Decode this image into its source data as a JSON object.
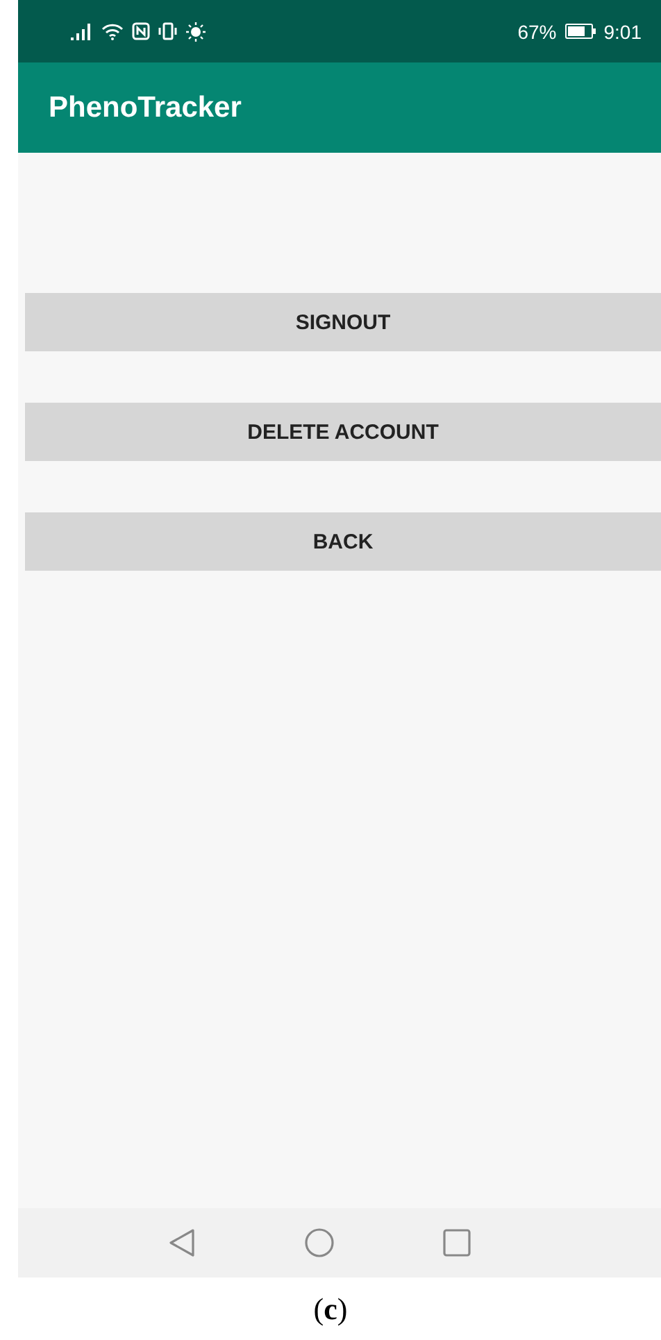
{
  "status_bar": {
    "battery_percent": "67%",
    "time": "9:01"
  },
  "app_bar": {
    "title": "PhenoTracker"
  },
  "buttons": [
    {
      "label": "SIGNOUT"
    },
    {
      "label": "DELETE ACCOUNT"
    },
    {
      "label": "BACK"
    }
  ],
  "caption": "(**c**)"
}
